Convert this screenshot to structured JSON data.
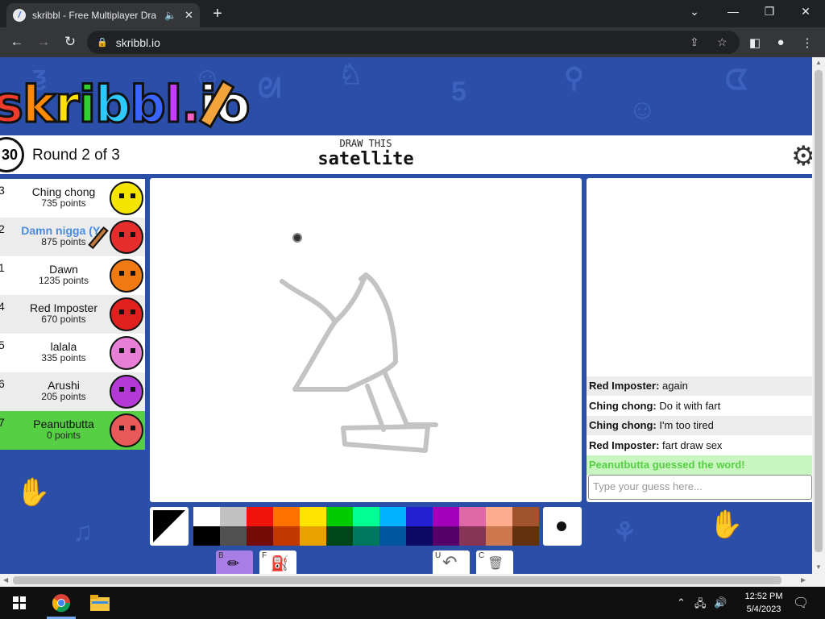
{
  "browser": {
    "tab_title": "skribbl - Free Multiplayer Dra",
    "url": "skribbl.io",
    "tab_close": "✕",
    "new_tab": "+",
    "window_controls": [
      "⌄",
      "—",
      "❐",
      "✕"
    ]
  },
  "game": {
    "logo": "skribbl.io",
    "timer": "30",
    "round_label": "Round 2 of 3",
    "draw_this_label": "DRAW THIS",
    "word": "satellite"
  },
  "players": [
    {
      "rank": "3",
      "name": "Ching chong",
      "points": "735 points",
      "color": "#f5e400",
      "bg": "#ffffff",
      "name_color": "#111111"
    },
    {
      "rank": "2",
      "name": "Damn nigga (Yo",
      "points": "875 points",
      "color": "#e52d2d",
      "bg": "#ececec",
      "name_color": "#4a8be0"
    },
    {
      "rank": "1",
      "name": "Dawn",
      "points": "1235 points",
      "color": "#f07a12",
      "bg": "#ffffff",
      "name_color": "#111111"
    },
    {
      "rank": "4",
      "name": "Red Imposter",
      "points": "670 points",
      "color": "#e01f1f",
      "bg": "#ececec",
      "name_color": "#111111"
    },
    {
      "rank": "5",
      "name": "lalala",
      "points": "335 points",
      "color": "#e87fd6",
      "bg": "#ffffff",
      "name_color": "#111111"
    },
    {
      "rank": "6",
      "name": "Arushi",
      "points": "205 points",
      "color": "#b33ad6",
      "bg": "#ececec",
      "name_color": "#111111"
    },
    {
      "rank": "7",
      "name": "Peanutbutta",
      "points": "0 points",
      "color": "#e85a5a",
      "bg": "#56cf45",
      "name_color": "#111111"
    }
  ],
  "chat": {
    "messages": [
      {
        "user": "Red Imposter:",
        "text": " again",
        "bg": "#ececec"
      },
      {
        "user": "Ching chong:",
        "text": " Do it with fart",
        "bg": "#ffffff"
      },
      {
        "user": "Ching chong:",
        "text": " I'm too tired",
        "bg": "#ececec"
      },
      {
        "user": "Red Imposter:",
        "text": " fart draw sex",
        "bg": "#ffffff"
      }
    ],
    "system_message": "Peanutbutta guessed the word!",
    "system_color": "#56cf45",
    "guess_placeholder": "Type your guess here..."
  },
  "palette": {
    "top": [
      "#ffffff",
      "#c1c1c1",
      "#ef130b",
      "#ff7100",
      "#ffe400",
      "#00cc00",
      "#00ff91",
      "#00b2ff",
      "#231fd3",
      "#a300ba",
      "#df69a7",
      "#ffac8e",
      "#a0522d"
    ],
    "bottom": [
      "#000000",
      "#505050",
      "#740b07",
      "#c23800",
      "#e8a200",
      "#004619",
      "#00785d",
      "#00569e",
      "#0e0865",
      "#550069",
      "#873554",
      "#cc774d",
      "#63300d"
    ]
  },
  "tools": [
    {
      "key": "B",
      "icon": "pencil-icon",
      "glyph": "✏"
    },
    {
      "key": "F",
      "icon": "fill-bucket-icon",
      "glyph": "⛽"
    },
    {
      "key": "U",
      "icon": "undo-icon",
      "glyph": "↶"
    },
    {
      "key": "C",
      "icon": "trash-icon",
      "glyph": "🗑"
    }
  ],
  "taskbar": {
    "time": "12:52 PM",
    "date": "5/4/2023"
  }
}
